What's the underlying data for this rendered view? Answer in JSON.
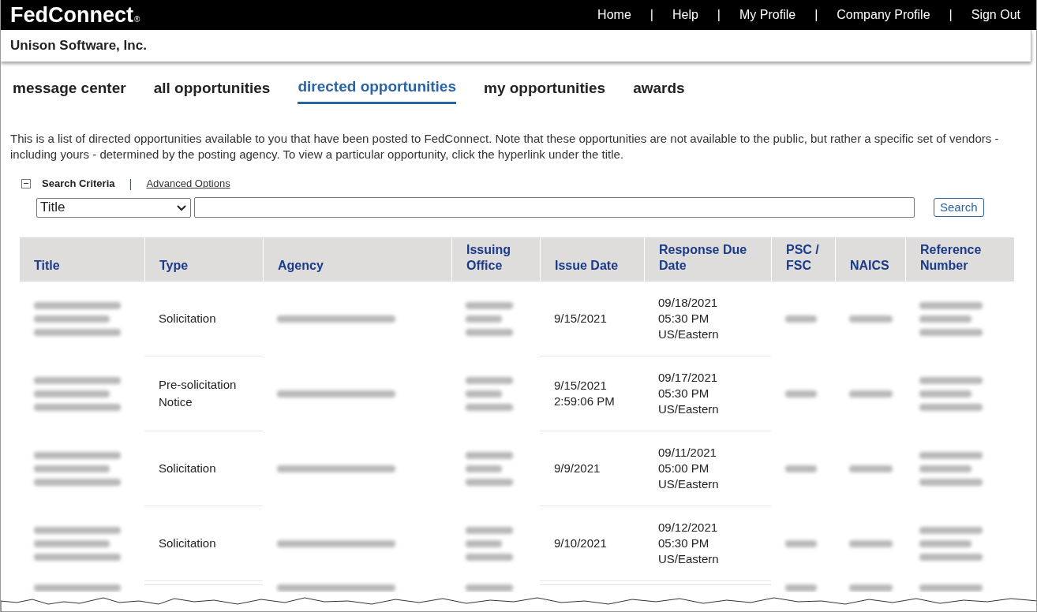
{
  "brand": {
    "name": "FedConnect",
    "mark": "®"
  },
  "top_nav": [
    "Home",
    "|",
    "Help",
    "|",
    "My Profile",
    "|",
    "Company Profile",
    "|",
    "Sign Out"
  ],
  "company": "Unison Software, Inc.",
  "tabs": [
    {
      "label": "message center",
      "selected": false
    },
    {
      "label": "all opportunities",
      "selected": false
    },
    {
      "label": "directed opportunities",
      "selected": true
    },
    {
      "label": "my opportunities",
      "selected": false
    },
    {
      "label": "awards",
      "selected": false
    }
  ],
  "description": "This is a list of directed opportunities available to you that have been posted to FedConnect. Note that these opportunities are not available to the public, but rather a specific set of vendors - including yours - determined by the posting agency. To view a particular opportunity, click the hyperlink under the title.",
  "search": {
    "expanded": true,
    "label": "Search Criteria",
    "separator": "|",
    "advanced_link": "Advanced Options",
    "field_select": "Title",
    "button": "Search"
  },
  "table": {
    "columns": [
      "Title",
      "Type",
      "Agency",
      "Issuing Office",
      "Issue Date",
      "Response Due Date",
      "PSC / FSC",
      "NAICS",
      "Reference Number"
    ],
    "rows": [
      {
        "type": "Solicitation",
        "issue_date": "9/15/2021",
        "response_due": "09/18/2021\n05:30 PM\nUS/Eastern"
      },
      {
        "type": "Pre-solicitation Notice",
        "issue_date": "9/15/2021\n2:59:06 PM",
        "response_due": "09/17/2021\n05:30 PM\nUS/Eastern"
      },
      {
        "type": "Solicitation",
        "issue_date": "9/9/2021",
        "response_due": "09/11/2021\n05:00 PM\nUS/Eastern"
      },
      {
        "type": "Solicitation",
        "issue_date": "9/10/2021",
        "response_due": "09/12/2021\n05:30 PM\nUS/Eastern"
      }
    ]
  }
}
